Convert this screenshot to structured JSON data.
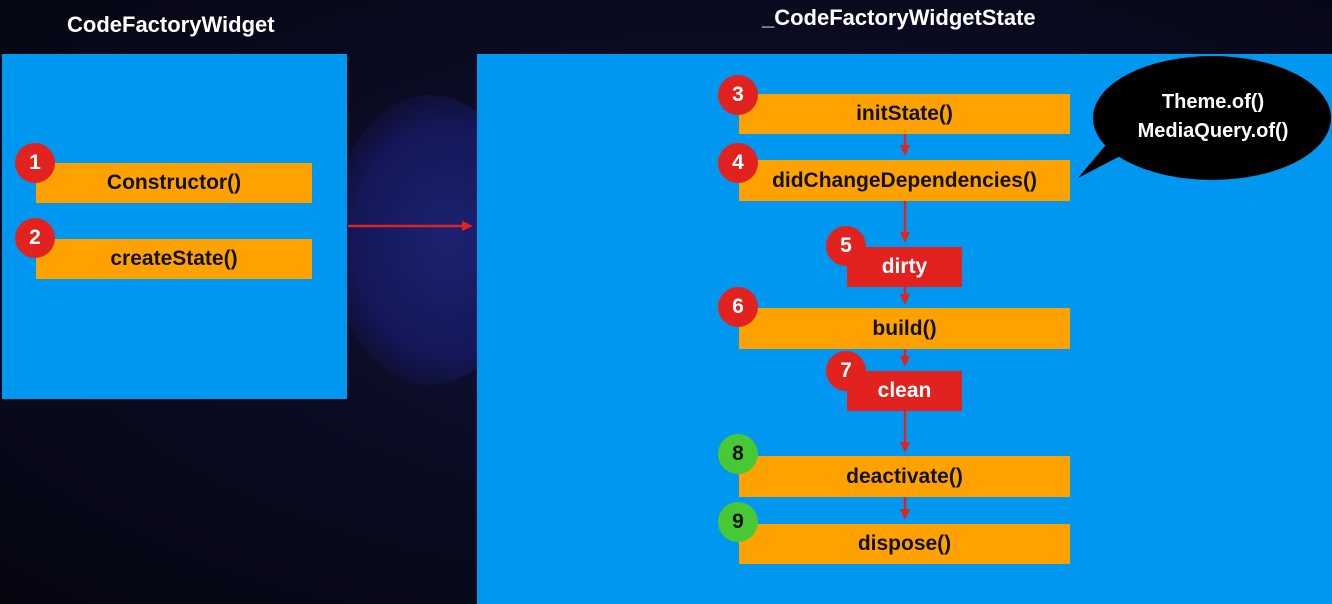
{
  "left_panel": {
    "title": "CodeFactoryWidget",
    "steps": [
      {
        "number": "1",
        "label": "Constructor()"
      },
      {
        "number": "2",
        "label": "createState()"
      }
    ]
  },
  "right_panel": {
    "title": "_CodeFactoryWidgetState",
    "steps": [
      {
        "number": "3",
        "label": "initState()"
      },
      {
        "number": "4",
        "label": "didChangeDependencies()"
      },
      {
        "number": "5",
        "label": "dirty"
      },
      {
        "number": "6",
        "label": "build()"
      },
      {
        "number": "7",
        "label": "clean"
      },
      {
        "number": "8",
        "label": "deactivate()"
      },
      {
        "number": "9",
        "label": "dispose()"
      }
    ],
    "callout": {
      "line1": "Theme.of()",
      "line2": "MediaQuery.of()"
    }
  },
  "colors": {
    "panel": "#0097f0",
    "method_box": "#ffa200",
    "state_box": "#e2221e",
    "badge_red": "#e2221e",
    "badge_green": "#46c934",
    "arrow": "#e2221e"
  }
}
